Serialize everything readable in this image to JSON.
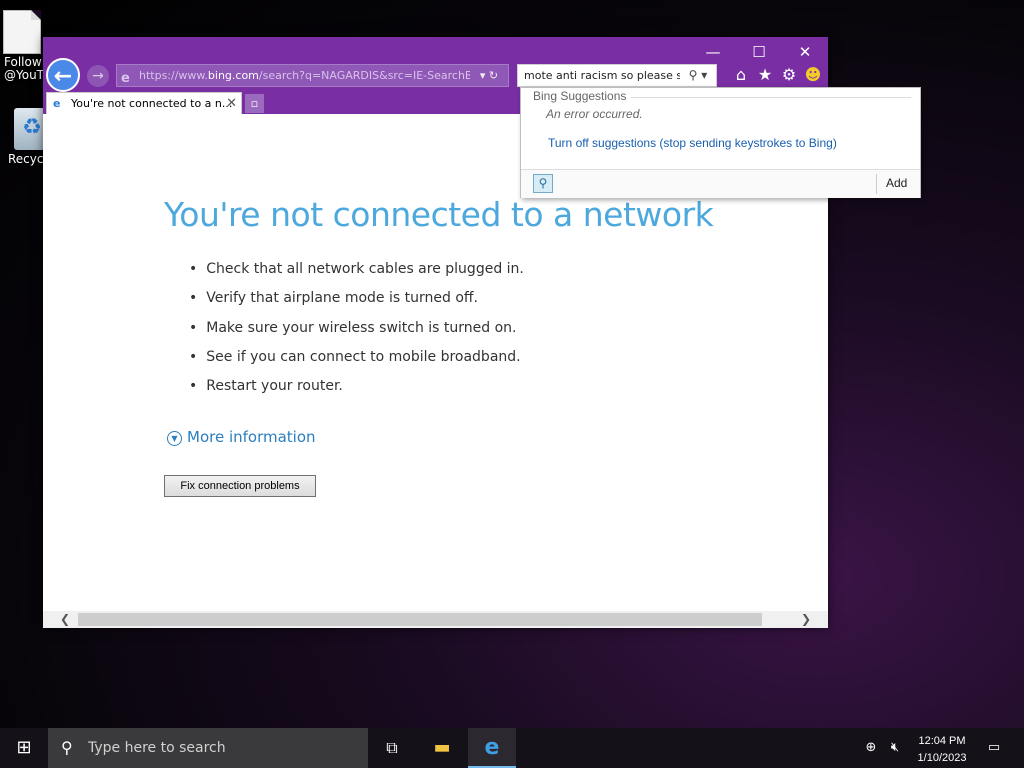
{
  "desktop": {
    "icons": [
      {
        "label": "Follow @YouT"
      },
      {
        "label": "Recycl"
      }
    ]
  },
  "browser": {
    "controls": {
      "minimize": "—",
      "maximize": "☐",
      "close": "✕"
    },
    "address": {
      "scheme": "https://www.",
      "host": "bing.com",
      "path": "/search?q=NAGARDIS&src=IE-SearchBo"
    },
    "search_box": {
      "value": "mote anti racism so please st"
    },
    "tab": {
      "title": "You're not connected to a n...",
      "close": "✕"
    },
    "page": {
      "heading": "You're not connected to a network",
      "tips": [
        "Check that all network cables are plugged in.",
        "Verify that airplane mode is turned off.",
        "Make sure your wireless switch is turned on.",
        "See if you can connect to mobile broadband.",
        "Restart your router."
      ],
      "more_information": "More information",
      "fix_button": "Fix connection problems"
    },
    "suggestions": {
      "title": "Bing Suggestions",
      "error": "An error occurred.",
      "turn_off_link": "Turn off suggestions (stop sending keystrokes to Bing)",
      "add_label": "Add"
    }
  },
  "taskbar": {
    "search_placeholder": "Type here to search",
    "time": "12:04 PM",
    "date": "1/10/2023"
  }
}
